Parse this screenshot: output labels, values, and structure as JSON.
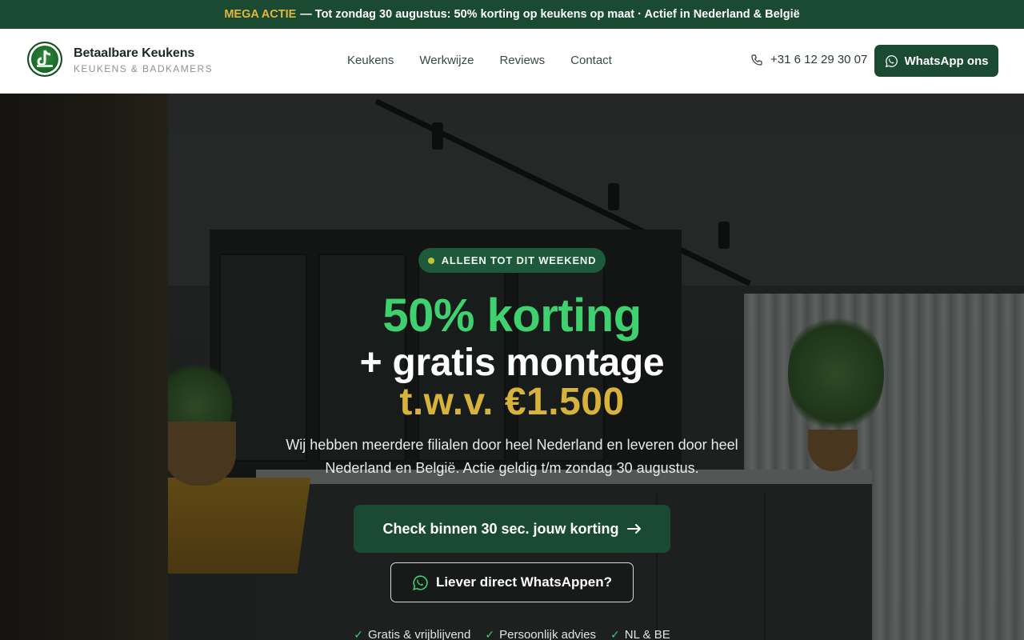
{
  "promo": {
    "highlight": "MEGA ACTIE",
    "text": "— Tot zondag 30 augustus: 50% korting op keukens op maat  ·  Actief in Nederland & België"
  },
  "header": {
    "brand_name": "Betaalbare Keukens",
    "brand_sub": "KEUKENS & BADKAMERS",
    "nav": [
      "Keukens",
      "Werkwijze",
      "Reviews",
      "Contact"
    ],
    "phone": "+31 6 12 29 30 07",
    "whatsapp_label": "WhatsApp ons"
  },
  "hero": {
    "badge": "ALLEEN TOT DIT WEEKEND",
    "headline_1": "50% korting",
    "headline_2": "+ gratis montage",
    "headline_3": "t.w.v. €1.500",
    "lead": "Wij hebben meerdere filialen door heel Nederland en leveren door heel Nederland en België. Actie geldig t/m zondag 30 augustus.",
    "cta_primary": "Check binnen 30 sec. jouw korting",
    "cta_secondary": "Liever direct WhatsAppen?",
    "checks": [
      "Gratis & vrijblijvend",
      "Persoonlijk advies",
      "NL & BE"
    ]
  },
  "colors": {
    "brand_green": "#1b4a33",
    "accent_green": "#3fd06f",
    "accent_gold": "#d8b33c"
  }
}
